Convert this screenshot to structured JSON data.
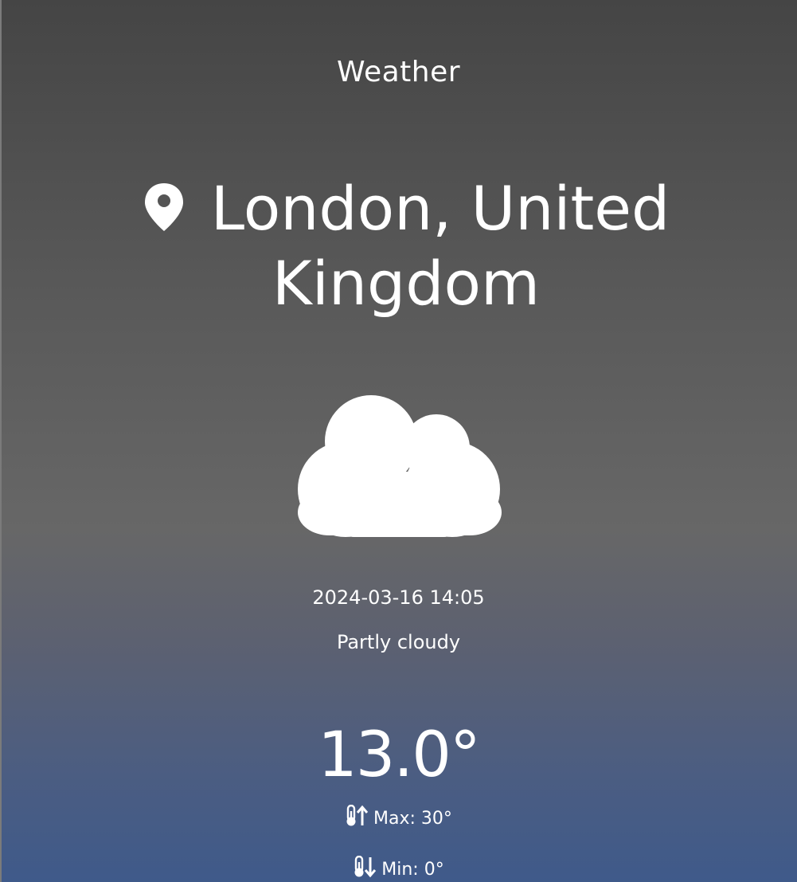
{
  "app": {
    "title": "Weather"
  },
  "location": {
    "icon": "map-pin-icon",
    "name": "London, United Kingdom"
  },
  "current": {
    "icon": "cloud-icon",
    "datetime": "2024-03-16 14:05",
    "condition": "Partly cloudy",
    "temperature": "13.0°",
    "max": {
      "icon": "thermometer-up-icon",
      "label": "Max: 30°"
    },
    "min": {
      "icon": "thermometer-down-icon",
      "label": "Min: 0°"
    }
  },
  "colors": {
    "text": "#ffffff",
    "background_top": "#454545",
    "background_bottom": "#3f5a8a"
  }
}
